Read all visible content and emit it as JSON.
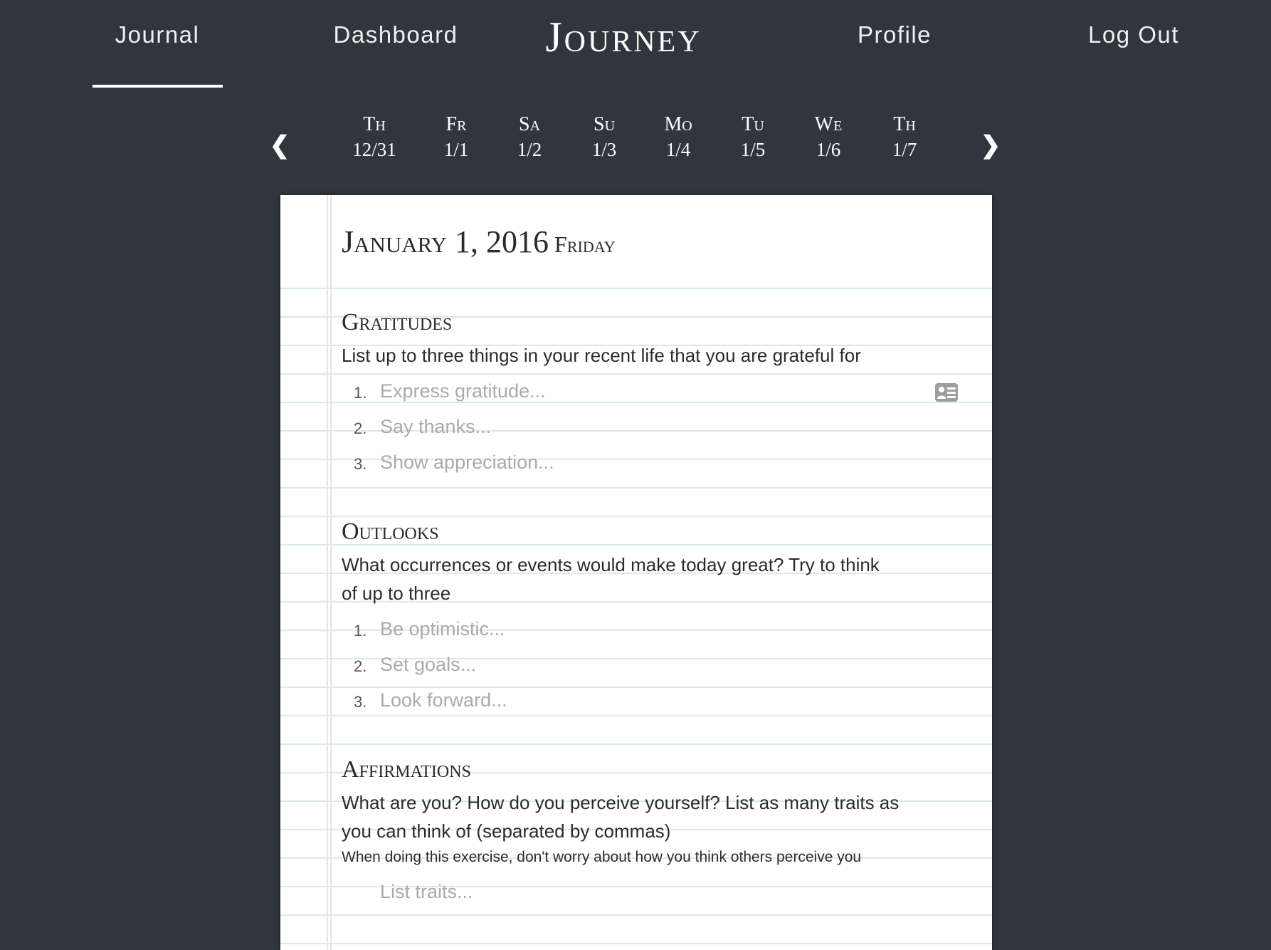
{
  "nav": {
    "journal": "Journal",
    "dashboard": "Dashboard",
    "logo": "Journey",
    "profile": "Profile",
    "logout": "Log Out"
  },
  "days": [
    {
      "day": "Th",
      "date": "12/31"
    },
    {
      "day": "Fr",
      "date": "1/1"
    },
    {
      "day": "Sa",
      "date": "1/2"
    },
    {
      "day": "Su",
      "date": "1/3"
    },
    {
      "day": "Mo",
      "date": "1/4"
    },
    {
      "day": "Tu",
      "date": "1/5"
    },
    {
      "day": "We",
      "date": "1/6"
    },
    {
      "day": "Th",
      "date": "1/7"
    }
  ],
  "entry": {
    "date": "January 1, 2016",
    "weekday": "Friday"
  },
  "gratitudes": {
    "heading": "Gratitudes",
    "prompt": "List up to three things in your recent life that you are grateful for",
    "items": [
      {
        "num": "1.",
        "placeholder": "Express gratitude..."
      },
      {
        "num": "2.",
        "placeholder": "Say thanks..."
      },
      {
        "num": "3.",
        "placeholder": "Show appreciation..."
      }
    ]
  },
  "outlooks": {
    "heading": "Outlooks",
    "prompt1": "What occurrences or events would make today great? Try to think",
    "prompt2": "of up to three",
    "items": [
      {
        "num": "1.",
        "placeholder": "Be optimistic..."
      },
      {
        "num": "2.",
        "placeholder": "Set goals..."
      },
      {
        "num": "3.",
        "placeholder": "Look forward..."
      }
    ]
  },
  "affirmations": {
    "heading": "Affirmations",
    "prompt1": "What are you? How do you perceive yourself? List as many traits as",
    "prompt2": "you can think of (separated by commas)",
    "note": "When doing this exercise, don't worry about how you think others perceive you",
    "placeholder": "List traits..."
  }
}
